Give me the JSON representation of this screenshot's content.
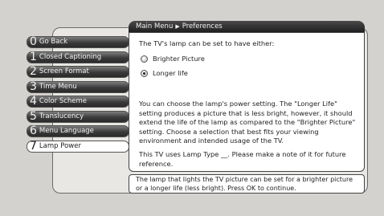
{
  "breadcrumb": {
    "root": "Main Menu",
    "separator": "▶",
    "current": "Preferences"
  },
  "menu": [
    {
      "num": "0",
      "label": "Go Back",
      "selected": false
    },
    {
      "num": "1",
      "label": "Closed Captioning",
      "selected": false
    },
    {
      "num": "2",
      "label": "Screen Format",
      "selected": false
    },
    {
      "num": "3",
      "label": "Time Menu",
      "selected": false
    },
    {
      "num": "4",
      "label": "Color Scheme",
      "selected": false
    },
    {
      "num": "5",
      "label": "Translucency",
      "selected": false
    },
    {
      "num": "6",
      "label": "Menu Language",
      "selected": false
    },
    {
      "num": "7",
      "label": "Lamp Power",
      "selected": true
    }
  ],
  "panel": {
    "prompt": "The TV's lamp can be set to have either:",
    "options": [
      {
        "label": "Brighter Picture",
        "checked": false
      },
      {
        "label": "Longer life",
        "checked": true
      }
    ],
    "description": "You can choose the lamp's power setting. The \"Longer Life\" setting produces a picture that is less bright, however, it should extend the life of the lamp as compared to the \"Brighter Picture\" setting. Choose a selection that best fits your viewing environment and intended usage of the TV.",
    "note": "This TV uses Lamp Type __. Please make a note of it for future reference."
  },
  "status": "The lamp that lights the TV picture can be set for a brighter picture or a longer life (less bright). Press OK to continue."
}
